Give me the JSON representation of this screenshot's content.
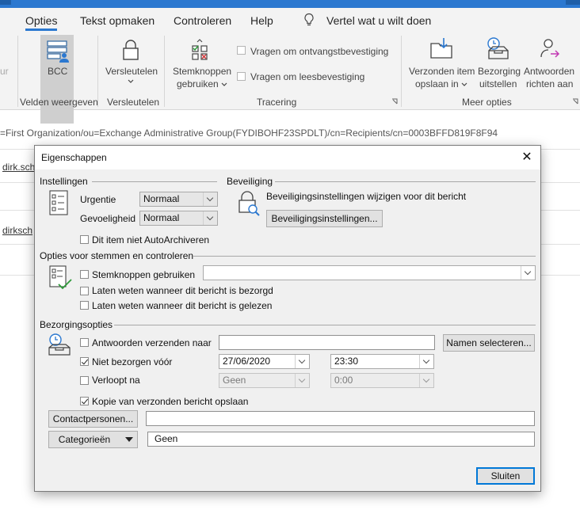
{
  "ribbon": {
    "tabs": [
      {
        "label": "Opties",
        "active": true
      },
      {
        "label": "Tekst opmaken"
      },
      {
        "label": "Controleren"
      },
      {
        "label": "Help"
      }
    ],
    "tell_me": "Vertel wat u wilt doen",
    "left_cut_text": "ur",
    "bcc_label": "BCC",
    "versleutelen_label": "Versleutelen",
    "stemknoppen_line1": "Stemknoppen",
    "stemknoppen_line2": "gebruiken",
    "vragen_ontvangst": "Vragen om ontvangstbevestiging",
    "vragen_lees": "Vragen om leesbevestiging",
    "verzonden_line1": "Verzonden item",
    "verzonden_line2": "opslaan in",
    "bezorging_line1": "Bezorging",
    "bezorging_line2": "uitstellen",
    "antwoorden_line1": "Antwoorden",
    "antwoorden_line2": "richten aan",
    "groups": {
      "velden": "Velden weergeven",
      "versleutelen": "Versleutelen",
      "tracering": "Tracering",
      "meer": "Meer opties"
    }
  },
  "background": {
    "address_line": "=First Organization/ou=Exchange Administrative Group(FYDIBOHF23SPDLT)/cn=Recipients/cn=0003BFFD819F8F94",
    "link1": "dirk.sch",
    "link2": "dirksch"
  },
  "dialog": {
    "title": "Eigenschappen",
    "close_glyph": "✕",
    "instellingen": {
      "header": "Instellingen",
      "urgentie_label": "Urgentie",
      "urgentie_value": "Normaal",
      "gevoeligheid_label": "Gevoeligheid",
      "gevoeligheid_value": "Normaal",
      "autoarchiveren_label": "Dit item niet AutoArchiveren",
      "autoarchiveren_checked": false
    },
    "beveiliging": {
      "header": "Beveiliging",
      "text": "Beveiligingsinstellingen wijzigen voor dit bericht",
      "button": "Beveiligingsinstellingen..."
    },
    "stemmen": {
      "header": "Opties voor stemmen en controleren",
      "stemknoppen_label": "Stemknoppen gebruiken",
      "stemknoppen_value": "",
      "bezorgd_label": "Laten weten wanneer dit bericht is bezorgd",
      "gelezen_label": "Laten weten wanneer dit bericht is gelezen"
    },
    "bezorging": {
      "header": "Bezorgingsopties",
      "antwoorden_label": "Antwoorden verzenden naar",
      "antwoorden_value": "",
      "namen_button": "Namen selecteren...",
      "niet_bezorgen_label": "Niet bezorgen vóór",
      "niet_bezorgen_checked": true,
      "niet_bezorgen_date": "27/06/2020",
      "niet_bezorgen_time": "23:30",
      "verloopt_label": "Verloopt na",
      "verloopt_checked": false,
      "verloopt_date": "Geen",
      "verloopt_time": "0:00",
      "kopie_label": "Kopie van verzonden bericht opslaan",
      "kopie_checked": true
    },
    "contactpersonen_button": "Contactpersonen...",
    "contactpersonen_value": "",
    "categorieen_button": "Categorieën",
    "categorieen_value": "Geen",
    "sluiten_button": "Sluiten"
  },
  "colors": {
    "accent": "#2b78d0",
    "dialog_bg": "#f0f0f0",
    "ribbon_bg": "#f3f3f3"
  }
}
